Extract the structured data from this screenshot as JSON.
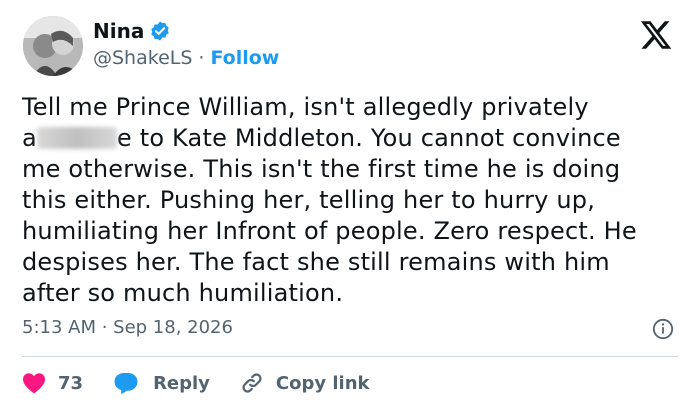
{
  "user": {
    "display_name": "Nina",
    "handle": "@ShakeLS",
    "follow_label": "Follow",
    "separator": "·"
  },
  "tweet": {
    "lines": [
      "Tell me Prince William, isn't allegedly privately",
      "e to Kate Middleton. You cannot convince",
      "me otherwise. This isn't the first time he is doing",
      "this either. Pushing her, telling her to hurry up,",
      "humiliating her Infront of people. Zero respect. He",
      "despises her. The fact she still remains with him",
      "after so much humiliation."
    ],
    "line2_prefix": "a",
    "timestamp": "5:13 AM · Sep 18, 2026"
  },
  "actions": {
    "like_count": "73",
    "reply_label": "Reply",
    "copy_link_label": "Copy link"
  },
  "colors": {
    "like": "#f91880",
    "reply": "#1d9bf0",
    "verified": "#1d9bf0",
    "link": "#1d9bf0",
    "muted": "#536471"
  },
  "icons": [
    "avatar",
    "verified-badge-icon",
    "x-logo-icon",
    "info-icon",
    "heart-icon",
    "reply-bubble-icon",
    "link-icon"
  ]
}
